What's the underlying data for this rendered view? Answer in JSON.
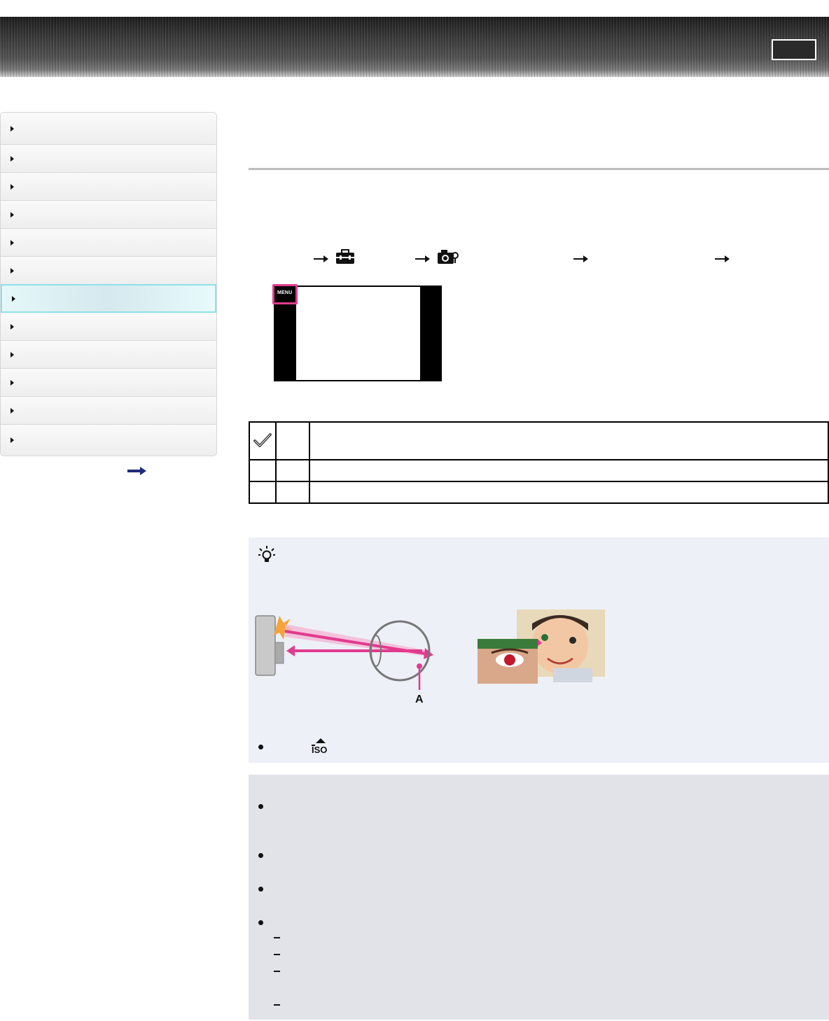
{
  "header": {
    "title": "",
    "top_button_label": ""
  },
  "sidebar": {
    "items": [
      {
        "label": ""
      },
      {
        "label": ""
      },
      {
        "label": ""
      },
      {
        "label": ""
      },
      {
        "label": ""
      },
      {
        "label": ""
      },
      {
        "label": "",
        "active": true
      },
      {
        "label": ""
      },
      {
        "label": ""
      },
      {
        "label": ""
      },
      {
        "label": ""
      },
      {
        "label": ""
      }
    ]
  },
  "main": {
    "title": "",
    "path": {
      "icons": [
        "setup-toolbox-icon",
        "shooting-settings-camera-icon"
      ]
    },
    "camera_screen": {
      "menu_button_label": "MENU"
    },
    "options_table": {
      "rows": [
        {
          "icon": "checkmark-icon",
          "name": "",
          "description": ""
        },
        {
          "icon": "",
          "name": "",
          "description": ""
        },
        {
          "icon": "",
          "name": "",
          "description": ""
        }
      ]
    },
    "hint": {
      "icon": "lightbulb-hint-icon",
      "diagram_label": "A",
      "bullet_icon": "iso-up-icon"
    },
    "notes": {
      "bullet_count": 4,
      "sub_dash_count": 4
    }
  },
  "colors": {
    "accent_pink": "#e13b8f",
    "active_nav_border": "#8fe1ea",
    "hint_background": "#edf0f6",
    "note_background": "#e1e3e8"
  }
}
